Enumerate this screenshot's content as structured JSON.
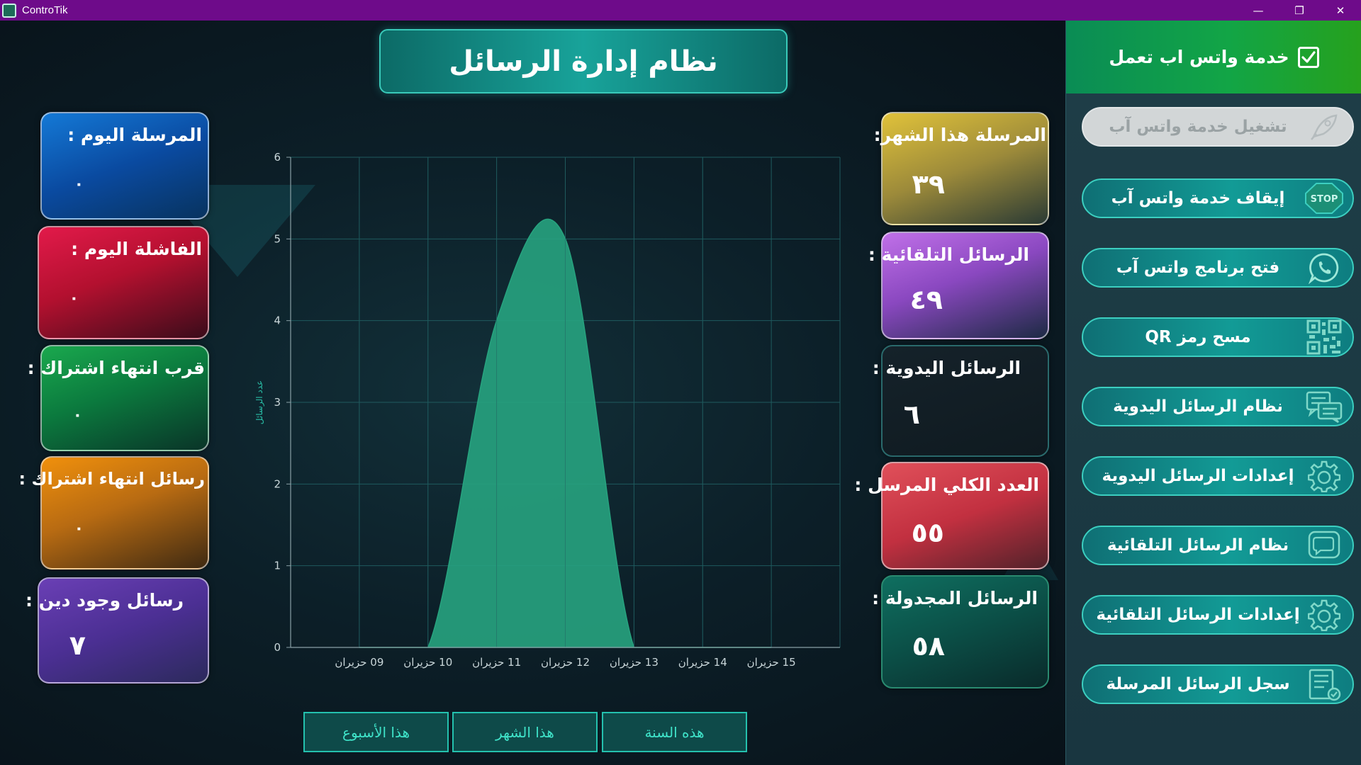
{
  "window": {
    "title": "ControTik",
    "controls": {
      "minimize": "—",
      "maximize": "❐",
      "close": "✕"
    }
  },
  "header": {
    "title": "نظام إدارة الرسائل"
  },
  "left_cards": [
    {
      "label": "المرسلة اليوم :",
      "value": "٠"
    },
    {
      "label": "الفاشلة اليوم :",
      "value": "٠"
    },
    {
      "label": "قرب انتهاء اشتراك :",
      "value": "٠"
    },
    {
      "label": "رسائل انتهاء اشتراك :",
      "value": "٠"
    },
    {
      "label": "رسائل وجود دين :",
      "value": "٧"
    }
  ],
  "right_cards": [
    {
      "label": "المرسلة  هذا الشهر:",
      "value": "٣٩"
    },
    {
      "label": "الرسائل التلقائية :",
      "value": "٤٩"
    },
    {
      "label": "الرسائل اليدوية :",
      "value": "٦"
    },
    {
      "label": "العدد الكلي المرسل :",
      "value": "٥٥"
    },
    {
      "label": "الرسائل المجدولة :",
      "value": "٥٨"
    }
  ],
  "chart_data": {
    "type": "area",
    "x": [
      "09 حزيران",
      "10 حزيران",
      "11 حزيران",
      "12 حزيران",
      "13 حزيران",
      "14 حزيران",
      "15 حزيران"
    ],
    "series": [
      {
        "values": [
          0,
          0,
          4,
          5,
          0,
          0,
          0
        ]
      }
    ],
    "ylabel": "عدد الرسائل",
    "xlabel": "",
    "ylim": [
      0,
      6
    ],
    "yticks": [
      "0",
      "1",
      "2",
      "3",
      "4",
      "5",
      "6"
    ],
    "grid": true,
    "color": "#27a37f"
  },
  "period_buttons": [
    {
      "label": "هذا الأسبوع"
    },
    {
      "label": "هذا الشهر"
    },
    {
      "label": "هذه السنة"
    }
  ],
  "sidebar": {
    "status": {
      "label": "خدمة واتس اب تعمل",
      "checked": true
    },
    "buttons": [
      {
        "label": "تشغيل خدمة واتس آب",
        "icon": "rocket-icon",
        "disabled": true
      },
      {
        "label": "إيقاف خدمة واتس آب",
        "icon": "stop-icon",
        "icon_text": "STOP"
      },
      {
        "label": "فتح برنامج واتس آب",
        "icon": "whatsapp-icon"
      },
      {
        "label": "مسح رمز QR",
        "icon": "qr-code-icon"
      },
      {
        "label": "نظام الرسائل اليدوية",
        "icon": "chat-messages-icon"
      },
      {
        "label": "إعدادات الرسائل اليدوية",
        "icon": "gear-icon"
      },
      {
        "label": "نظام الرسائل التلقائية",
        "icon": "chat-bubble-icon"
      },
      {
        "label": "إعدادات الرسائل التلقائية",
        "icon": "gear-icon"
      },
      {
        "label": "سجل الرسائل المرسلة",
        "icon": "log-list-icon"
      }
    ]
  },
  "colors": {
    "sent_today": "#0a4fa0",
    "failed_today": "#c4133a",
    "near_expiry": "#0f8c4c",
    "expiry_msgs": "#e08a0b",
    "debt_msgs": "#4b2f93",
    "sent_month": "#d4b636",
    "auto_msgs": "#a45bd0",
    "manual_msgs": "#121a20",
    "total_sent": "#d9404d",
    "scheduled": "#0d5c52",
    "accent": "#3ccfc0"
  }
}
